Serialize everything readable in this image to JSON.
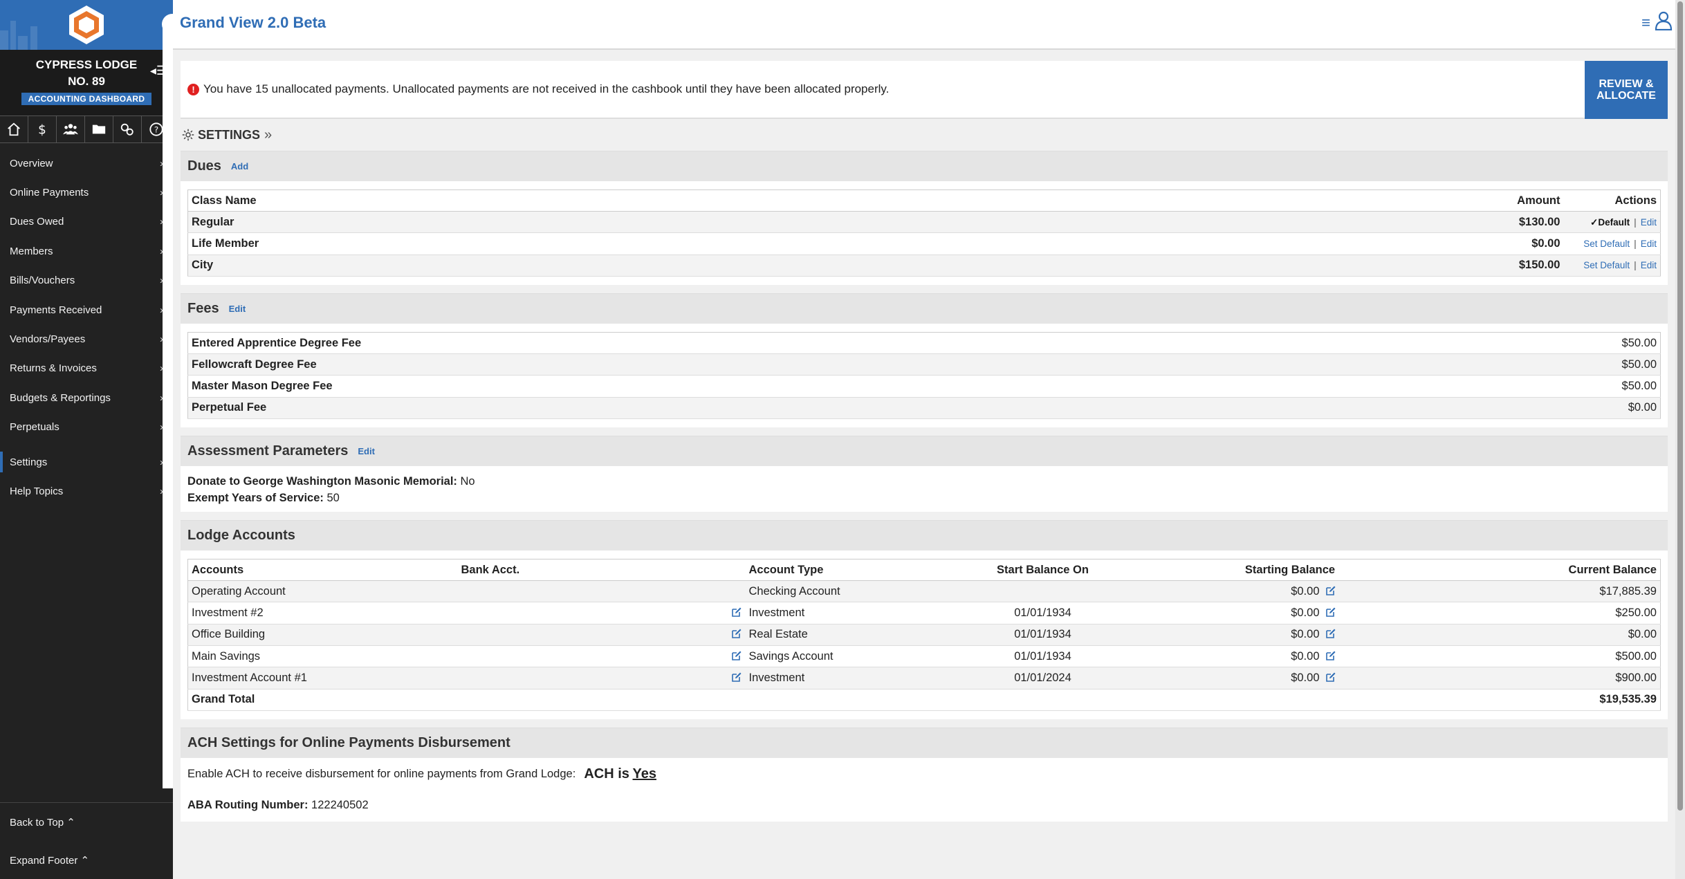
{
  "sidebar": {
    "lodge_name": "CYPRESS LODGE NO. 89",
    "badge": "ACCOUNTING DASHBOARD",
    "icons": [
      "home-icon",
      "dollar-icon",
      "members-icon",
      "folder-icon",
      "settings-icon",
      "help-icon"
    ],
    "menu": [
      {
        "label": "Overview"
      },
      {
        "label": "Online Payments"
      },
      {
        "label": "Dues Owed"
      },
      {
        "label": "Members"
      },
      {
        "label": "Bills/Vouchers"
      },
      {
        "label": "Payments Received"
      },
      {
        "label": "Vendors/Payees"
      },
      {
        "label": "Returns & Invoices"
      },
      {
        "label": "Budgets & Reportings"
      },
      {
        "label": "Perpetuals"
      },
      {
        "label": "Settings"
      },
      {
        "label": "Help Topics"
      }
    ],
    "footer": {
      "back_to_top": "Back to Top ⌃",
      "expand_footer": "Expand Footer ⌃"
    },
    "accent": "#2f6db5"
  },
  "header": {
    "title": "Grand View 2.0 Beta"
  },
  "alert": {
    "text": "You have 15 unallocated payments. Unallocated payments are not received in the cashbook until they have been allocated properly.",
    "button": "REVIEW & ALLOCATE",
    "icon": "!"
  },
  "settings": {
    "heading": "SETTINGS"
  },
  "dues": {
    "title": "Dues",
    "add": "Add",
    "headers": {
      "class": "Class Name",
      "amount": "Amount",
      "actions": "Actions"
    },
    "rows": [
      {
        "name": "Regular",
        "amount": "$130.00",
        "default": "Default",
        "edit": "Edit"
      },
      {
        "name": "Life Member",
        "amount": "$0.00",
        "set_default": "Set Default",
        "edit": "Edit"
      },
      {
        "name": "City",
        "amount": "$150.00",
        "set_default": "Set Default",
        "edit": "Edit"
      }
    ]
  },
  "fees": {
    "title": "Fees",
    "edit": "Edit",
    "rows": [
      {
        "name": "Entered Apprentice Degree Fee",
        "amount": "$50.00"
      },
      {
        "name": "Fellowcraft Degree Fee",
        "amount": "$50.00"
      },
      {
        "name": "Master Mason Degree Fee",
        "amount": "$50.00"
      },
      {
        "name": "Perpetual Fee",
        "amount": "$0.00"
      }
    ]
  },
  "assessment": {
    "title": "Assessment Parameters",
    "edit": "Edit",
    "donate_label": "Donate to George Washington Masonic Memorial:",
    "donate_value": "No",
    "exempt_label": "Exempt Years of Service:",
    "exempt_value": "50"
  },
  "accounts": {
    "title": "Lodge Accounts",
    "headers": {
      "accounts": "Accounts",
      "bank": "Bank Acct.",
      "type": "Account Type",
      "start": "Start Balance On",
      "starting": "Starting Balance",
      "current": "Current Balance"
    },
    "rows": [
      {
        "name": "Operating Account",
        "type": "Checking Account",
        "start": "",
        "starting": "$0.00",
        "current": "$17,885.39"
      },
      {
        "name": "Investment #2",
        "type": "Investment",
        "start": "01/01/1934",
        "starting": "$0.00",
        "current": "$250.00"
      },
      {
        "name": "Office Building",
        "type": "Real Estate",
        "start": "01/01/1934",
        "starting": "$0.00",
        "current": "$0.00"
      },
      {
        "name": "Main Savings",
        "type": "Savings Account",
        "start": "01/01/1934",
        "starting": "$0.00",
        "current": "$500.00"
      },
      {
        "name": "Investment Account #1",
        "type": "Investment",
        "start": "01/01/2024",
        "starting": "$0.00",
        "current": "$900.00"
      }
    ],
    "total_label": "Grand Total",
    "total_value": "$19,535.39"
  },
  "ach": {
    "title": "ACH Settings for Online Payments Disbursement",
    "enable_text": "Enable ACH to receive disbursement for online payments from Grand Lodge:",
    "status_prefix": "ACH is",
    "status_value": "Yes",
    "routing_label": "ABA Routing Number:",
    "routing_value": "122240502"
  }
}
